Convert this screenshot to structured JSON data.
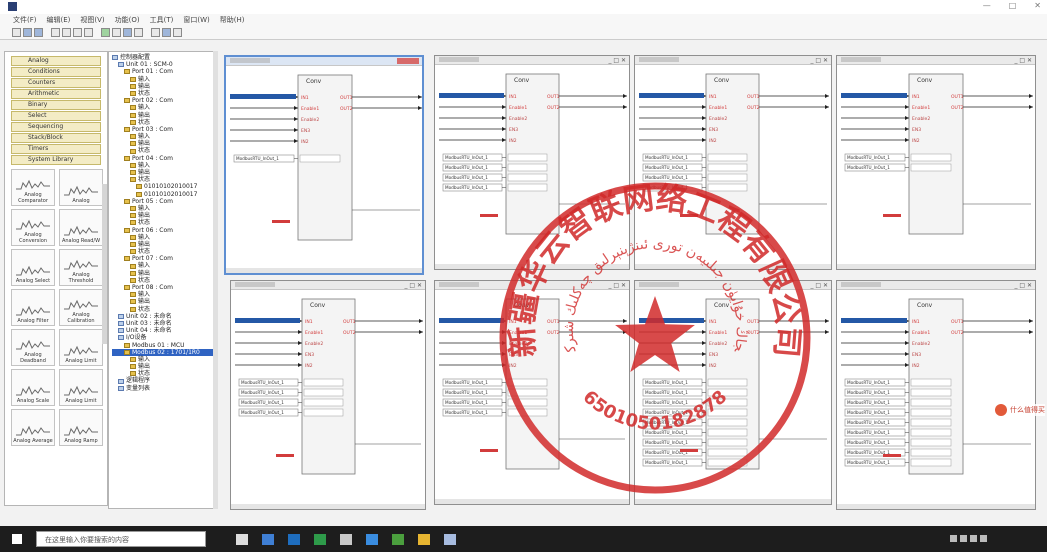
{
  "menu": {
    "items": [
      "文件(F)",
      "编辑(E)",
      "视图(V)",
      "功能(O)",
      "工具(T)",
      "窗口(W)",
      "帮助(H)"
    ]
  },
  "library": {
    "categories": [
      "Analog",
      "Conditions",
      "Counters",
      "Arithmetic",
      "Binary",
      "Select",
      "Sequencing",
      "Stack/Block",
      "Timers",
      "System Library"
    ],
    "blocks": [
      "Analog Comparator",
      "Analog",
      "Analog Conversion",
      "Analog Read/W",
      "Analog Select",
      "Analog Threshold",
      "Analog Filter",
      "Analog Calibration",
      "Analog Deadband",
      "Analog Limit",
      "Analog Scale",
      "Analog Limit",
      "Analog Average",
      "Analog Ramp"
    ]
  },
  "tree": {
    "nodes": [
      {
        "text": "控制器配置",
        "indent": 0,
        "selected": false
      },
      {
        "text": "Unit 01 : SCM-0",
        "indent": 1,
        "selected": false
      },
      {
        "text": "Port 01 : Com",
        "indent": 2,
        "selected": false
      },
      {
        "text": "输入",
        "indent": 3,
        "selected": false
      },
      {
        "text": "输出",
        "indent": 3,
        "selected": false
      },
      {
        "text": "状态",
        "indent": 3,
        "selected": false
      },
      {
        "text": "Port 02 : Com",
        "indent": 2,
        "selected": false
      },
      {
        "text": "输入",
        "indent": 3,
        "selected": false
      },
      {
        "text": "输出",
        "indent": 3,
        "selected": false
      },
      {
        "text": "状态",
        "indent": 3,
        "selected": false
      },
      {
        "text": "Port 03 : Com",
        "indent": 2,
        "selected": false
      },
      {
        "text": "输入",
        "indent": 3,
        "selected": false
      },
      {
        "text": "输出",
        "indent": 3,
        "selected": false
      },
      {
        "text": "状态",
        "indent": 3,
        "selected": false
      },
      {
        "text": "Port 04 : Com",
        "indent": 2,
        "selected": false
      },
      {
        "text": "输入",
        "indent": 3,
        "selected": false
      },
      {
        "text": "输出",
        "indent": 3,
        "selected": false
      },
      {
        "text": "状态",
        "indent": 3,
        "selected": false
      },
      {
        "text": "01010102010017",
        "indent": 4,
        "selected": false
      },
      {
        "text": "01010102010017",
        "indent": 4,
        "selected": false
      },
      {
        "text": "Port 05 : Com",
        "indent": 2,
        "selected": false
      },
      {
        "text": "输入",
        "indent": 3,
        "selected": false
      },
      {
        "text": "输出",
        "indent": 3,
        "selected": false
      },
      {
        "text": "状态",
        "indent": 3,
        "selected": false
      },
      {
        "text": "Port 06 : Com",
        "indent": 2,
        "selected": false
      },
      {
        "text": "输入",
        "indent": 3,
        "selected": false
      },
      {
        "text": "输出",
        "indent": 3,
        "selected": false
      },
      {
        "text": "状态",
        "indent": 3,
        "selected": false
      },
      {
        "text": "Port 07 : Com",
        "indent": 2,
        "selected": false
      },
      {
        "text": "输入",
        "indent": 3,
        "selected": false
      },
      {
        "text": "输出",
        "indent": 3,
        "selected": false
      },
      {
        "text": "状态",
        "indent": 3,
        "selected": false
      },
      {
        "text": "Port 08 : Com",
        "indent": 2,
        "selected": false
      },
      {
        "text": "输入",
        "indent": 3,
        "selected": false
      },
      {
        "text": "输出",
        "indent": 3,
        "selected": false
      },
      {
        "text": "状态",
        "indent": 3,
        "selected": false
      },
      {
        "text": "Unit 02 : 未命名",
        "indent": 1,
        "selected": false
      },
      {
        "text": "Unit 03 : 未命名",
        "indent": 1,
        "selected": false
      },
      {
        "text": "Unit 04 : 未命名",
        "indent": 1,
        "selected": false
      },
      {
        "text": "I/O设备",
        "indent": 1,
        "selected": false
      },
      {
        "text": "Modbus 01 : MCU",
        "indent": 2,
        "selected": false
      },
      {
        "text": "Modbus 02 : 1701/1R0",
        "indent": 2,
        "selected": true
      },
      {
        "text": "输入",
        "indent": 3,
        "selected": false
      },
      {
        "text": "输出",
        "indent": 3,
        "selected": false
      },
      {
        "text": "状态",
        "indent": 3,
        "selected": false
      },
      {
        "text": "逻辑程序",
        "indent": 1,
        "selected": false
      },
      {
        "text": "变量列表",
        "indent": 1,
        "selected": false
      }
    ]
  },
  "block": {
    "title": "Conv",
    "pins_in": [
      "IN1",
      "Enable1",
      "Enable2",
      "EN3",
      "IN2"
    ],
    "pins_out": [
      "OUT1",
      "OUT2"
    ],
    "field_label": "ModbusRTU_InOut_1"
  },
  "taskbar": {
    "search_placeholder": "在这里输入你要搜索的内容"
  },
  "watermark": {
    "text": "什么值得买"
  },
  "stamp": {
    "name": "新疆华云智联网络工程有限公司",
    "code": "6501050182878"
  }
}
